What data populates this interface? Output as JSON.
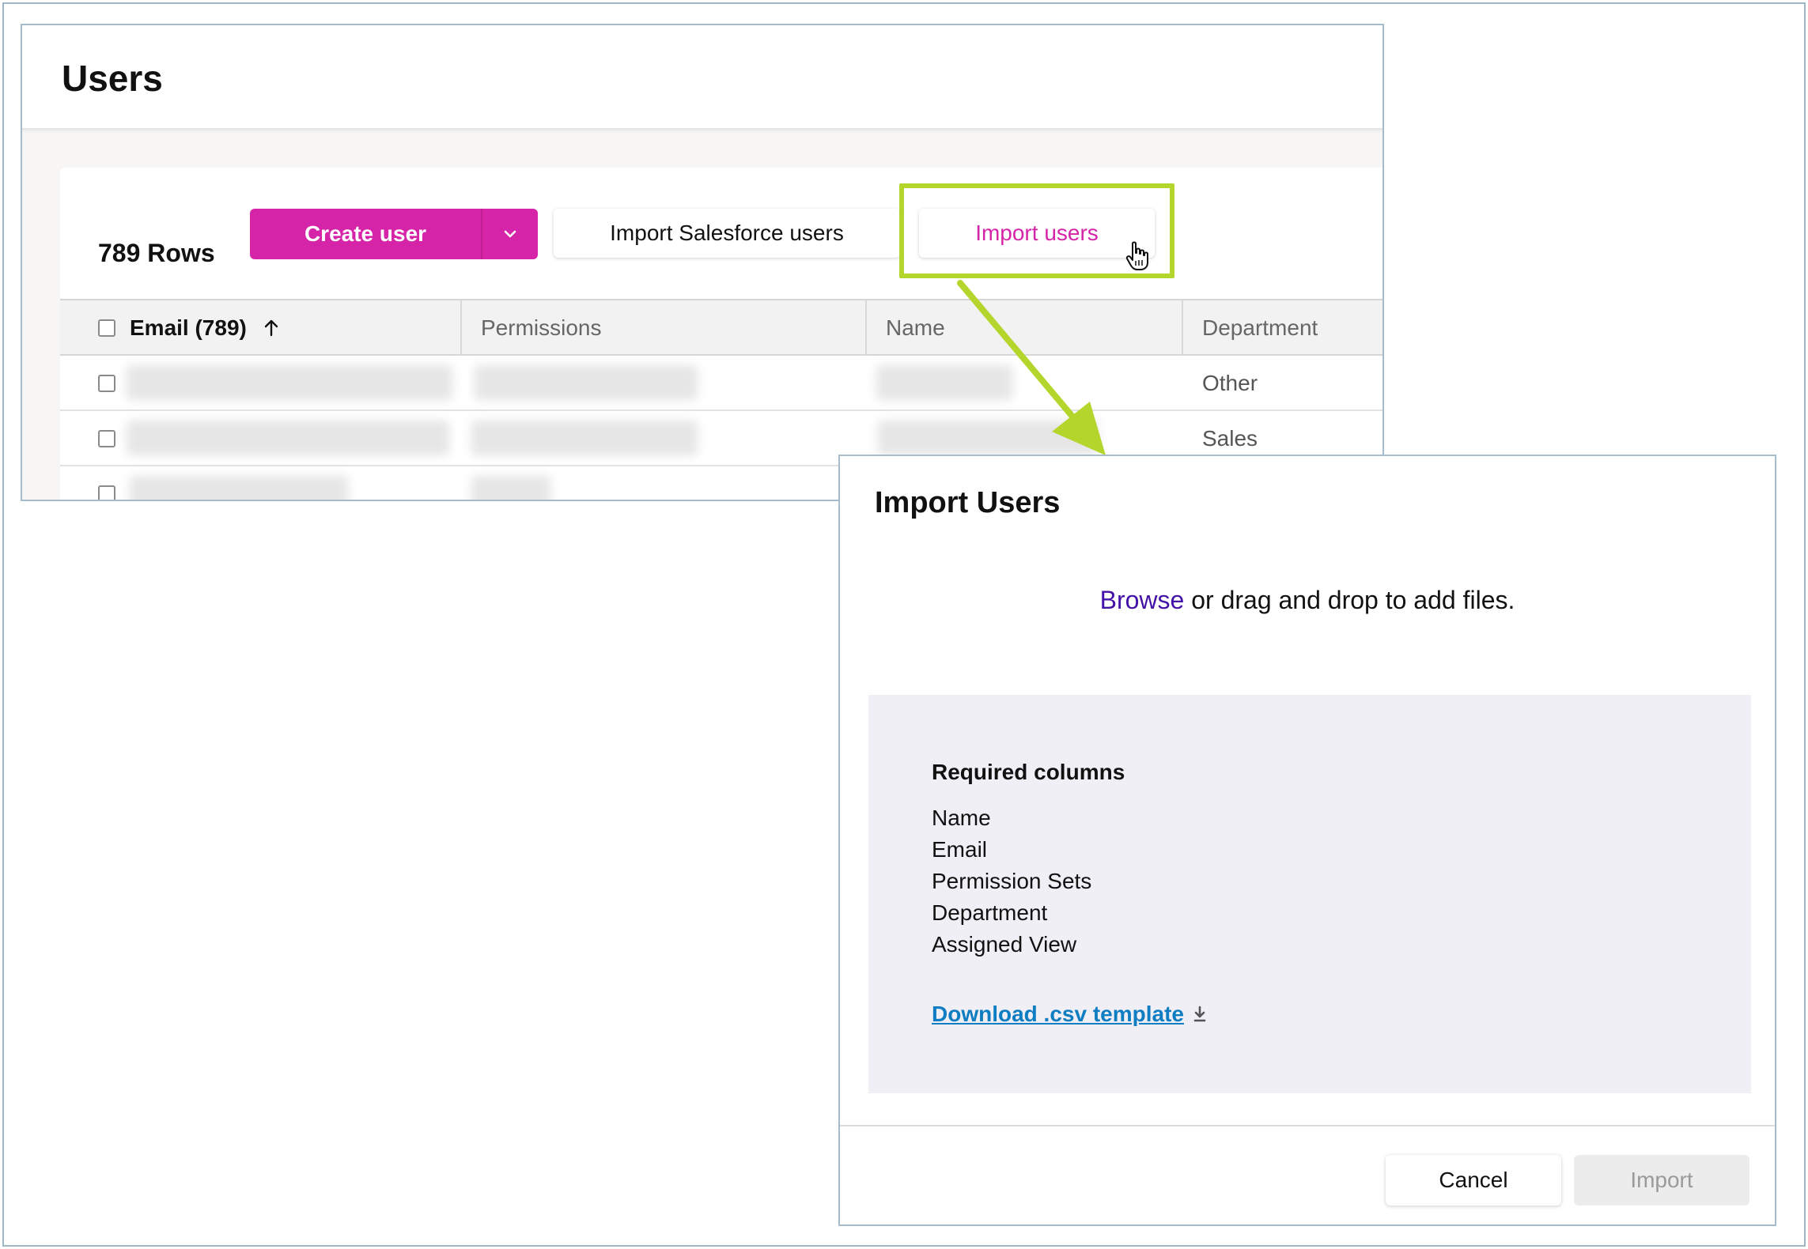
{
  "users_page": {
    "title": "Users",
    "row_count": "789 Rows",
    "create_user_label": "Create user",
    "import_salesforce_label": "Import Salesforce users",
    "import_users_label": "Import users",
    "table": {
      "columns": [
        "Email (789)",
        "Permissions",
        "Name",
        "Department"
      ],
      "rows": [
        {
          "department": "Other"
        },
        {
          "department": "Sales"
        },
        {
          "department": ""
        }
      ]
    }
  },
  "modal": {
    "title": "Import Users",
    "browse_label": "Browse",
    "dropzone_rest": " or drag and drop to add files.",
    "required_heading": "Required columns",
    "required_columns": [
      "Name",
      "Email",
      "Permission Sets",
      "Department",
      "Assigned View"
    ],
    "download_label": "Download .csv template",
    "cancel_label": "Cancel",
    "import_label": "Import"
  },
  "colors": {
    "brand": "#d524a8",
    "highlight": "#b4d62c",
    "link": "#0f7dc2",
    "browse": "#4412a8"
  },
  "icons": [
    "chevron-down-icon",
    "sort-up-icon",
    "hand-cursor-icon",
    "download-icon",
    "arrow-icon"
  ]
}
